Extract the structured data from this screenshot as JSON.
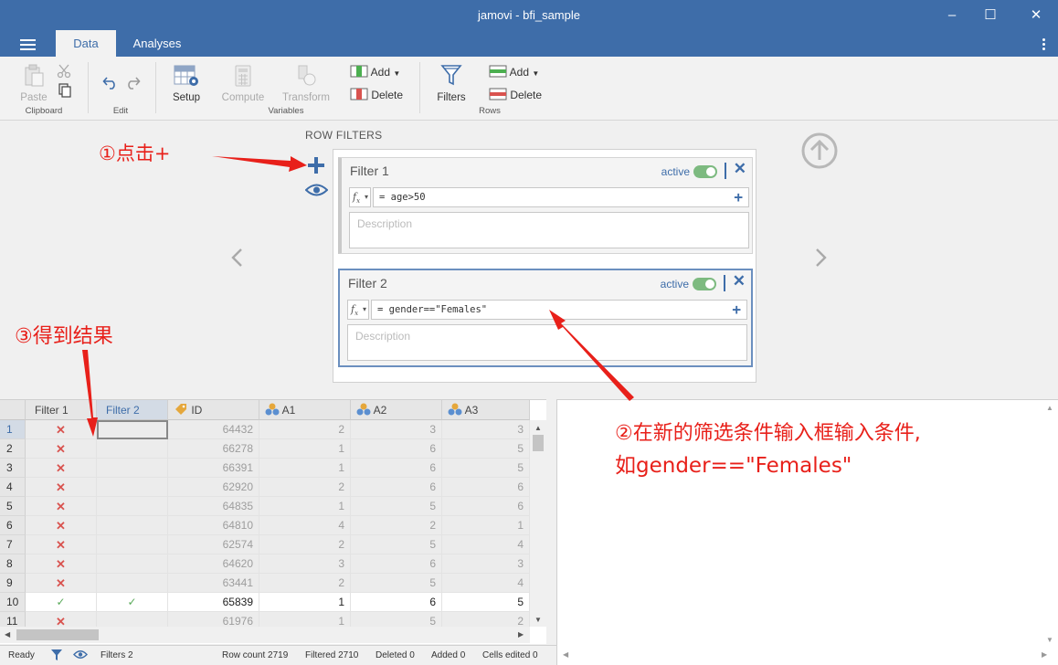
{
  "window": {
    "title": "jamovi - bfi_sample"
  },
  "menu": {
    "tabs": [
      {
        "label": "Data"
      },
      {
        "label": "Analyses"
      }
    ]
  },
  "ribbon": {
    "clipboard": {
      "paste": "Paste",
      "group": "Clipboard"
    },
    "edit": {
      "group": "Edit"
    },
    "variables": {
      "setup": "Setup",
      "compute": "Compute",
      "transform": "Transform",
      "add": "Add",
      "delete": "Delete",
      "group": "Variables"
    },
    "rows": {
      "filters": "Filters",
      "add": "Add",
      "delete": "Delete",
      "group": "Rows"
    }
  },
  "row_filters": {
    "heading": "ROW FILTERS",
    "filters": [
      {
        "name": "Filter 1",
        "status": "active",
        "formula": "= age>50",
        "description_placeholder": "Description"
      },
      {
        "name": "Filter 2",
        "status": "active",
        "formula": "= gender==\"Females\"",
        "description_placeholder": "Description"
      }
    ]
  },
  "grid": {
    "columns": [
      "Filter 1",
      "Filter 2",
      "ID",
      "A1",
      "A2",
      "A3"
    ],
    "rows": [
      {
        "n": "1",
        "f1": "x",
        "f2": "",
        "id": "64432",
        "a1": "2",
        "a2": "3",
        "a3": "3",
        "kept": false
      },
      {
        "n": "2",
        "f1": "x",
        "f2": "",
        "id": "66278",
        "a1": "1",
        "a2": "6",
        "a3": "5",
        "kept": false
      },
      {
        "n": "3",
        "f1": "x",
        "f2": "",
        "id": "66391",
        "a1": "1",
        "a2": "6",
        "a3": "5",
        "kept": false
      },
      {
        "n": "4",
        "f1": "x",
        "f2": "",
        "id": "62920",
        "a1": "2",
        "a2": "6",
        "a3": "6",
        "kept": false
      },
      {
        "n": "5",
        "f1": "x",
        "f2": "",
        "id": "64835",
        "a1": "1",
        "a2": "5",
        "a3": "6",
        "kept": false
      },
      {
        "n": "6",
        "f1": "x",
        "f2": "",
        "id": "64810",
        "a1": "4",
        "a2": "2",
        "a3": "1",
        "kept": false
      },
      {
        "n": "7",
        "f1": "x",
        "f2": "",
        "id": "62574",
        "a1": "2",
        "a2": "5",
        "a3": "4",
        "kept": false
      },
      {
        "n": "8",
        "f1": "x",
        "f2": "",
        "id": "64620",
        "a1": "3",
        "a2": "6",
        "a3": "3",
        "kept": false
      },
      {
        "n": "9",
        "f1": "x",
        "f2": "",
        "id": "63441",
        "a1": "2",
        "a2": "5",
        "a3": "4",
        "kept": false
      },
      {
        "n": "10",
        "f1": "✓",
        "f2": "✓",
        "id": "65839",
        "a1": "1",
        "a2": "6",
        "a3": "5",
        "kept": true
      },
      {
        "n": "11",
        "f1": "x",
        "f2": "",
        "id": "61976",
        "a1": "1",
        "a2": "5",
        "a3": "2",
        "kept": false
      }
    ]
  },
  "status_bar": {
    "ready": "Ready",
    "filters": "Filters 2",
    "row_count": "Row count 2719",
    "filtered": "Filtered 2710",
    "deleted": "Deleted 0",
    "added": "Added 0",
    "cells_edited": "Cells edited 0"
  },
  "annotations": {
    "step1": "①点击+",
    "step2_line1": "②在新的筛选条件输入框输入条件,",
    "step2_line2": "如gender==\"Females\"",
    "step3": "③得到结果"
  },
  "colors": {
    "brand": "#3e6da9",
    "annotation": "#e8201a",
    "toggle_on": "#7dba80",
    "filtered_out": "#d9534f",
    "kept": "#5aaa5a"
  }
}
